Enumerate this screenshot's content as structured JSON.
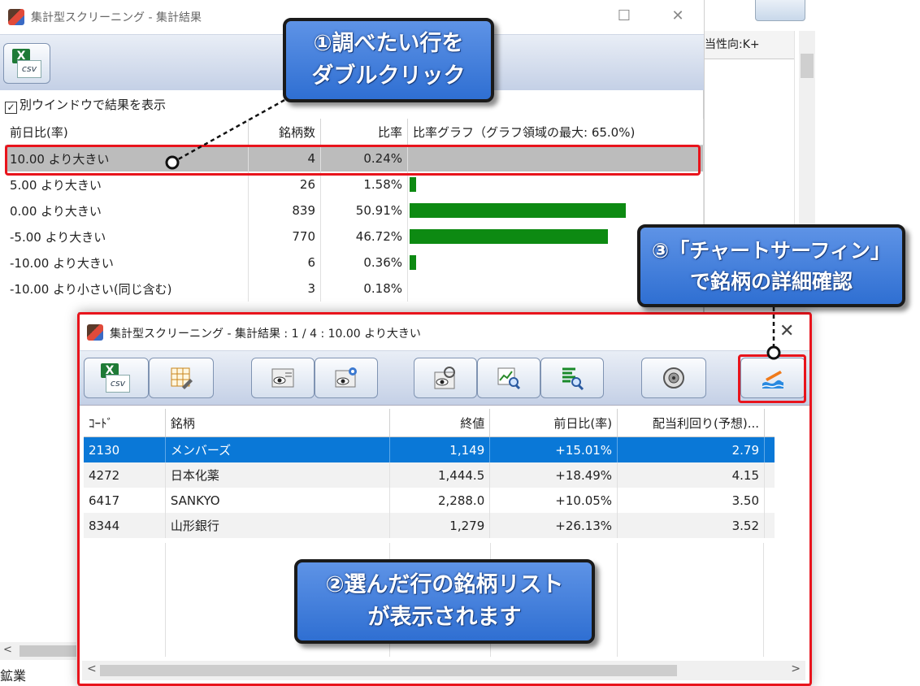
{
  "background_window": {
    "column_header": "当性向:K+",
    "toolbar_button_icon": "chart-surfin-icon"
  },
  "window1": {
    "title": "集計型スクリーニング - 集計結果",
    "toolbar": {
      "csv_icon": "excel-csv-icon",
      "csv_label": "csv",
      "excel_glyph": "X"
    },
    "checkbox_label": "別ウインドウで結果を表示",
    "checkbox_checked": true,
    "table": {
      "headers": [
        "前日比(率)",
        "銘柄数",
        "比率",
        "比率グラフ（グラフ領域の最大: 65.0%)"
      ],
      "rows": [
        {
          "label": "10.00 より大きい",
          "count": "4",
          "ratio": "0.24%",
          "graph": 0.0024
        },
        {
          "label": "5.00 より大きい",
          "count": "26",
          "ratio": "1.58%",
          "graph": 0.0158
        },
        {
          "label": "0.00 より大きい",
          "count": "839",
          "ratio": "50.91%",
          "graph": 0.5091
        },
        {
          "label": "-5.00 より大きい",
          "count": "770",
          "ratio": "46.72%",
          "graph": 0.4672
        },
        {
          "label": "-10.00 より大きい",
          "count": "6",
          "ratio": "0.36%",
          "graph": 0.0036
        },
        {
          "label": "-10.00 より小さい(同じ含む)",
          "count": "3",
          "ratio": "0.18%",
          "graph": 0.0018
        }
      ],
      "graph_max": 0.65,
      "bar_color": "#0d8a12"
    },
    "status_text": "鉱業"
  },
  "window2": {
    "title": "集計型スクリーニング - 集計結果 : 1 / 4 : 10.00 より大きい",
    "toolbar_icons": [
      "excel-csv-icon",
      "edit-grid-icon",
      "eye-list-icon",
      "eye-settings-icon",
      "eye-refresh-icon",
      "chart-search-icon",
      "list-search-icon",
      "speaker-icon",
      "chart-surfin-icon"
    ],
    "table": {
      "headers": [
        "ｺｰﾄﾞ",
        "銘柄",
        "終値",
        "前日比(率)",
        "配当利回り(予想)..."
      ],
      "rows": [
        {
          "code": "2130",
          "name": "メンバーズ",
          "close": "1,149",
          "change": "+15.01%",
          "yield": "2.79"
        },
        {
          "code": "4272",
          "name": "日本化薬",
          "close": "1,444.5",
          "change": "+18.49%",
          "yield": "4.15"
        },
        {
          "code": "6417",
          "name": "SANKYO",
          "close": "2,288.0",
          "change": "+10.05%",
          "yield": "3.50"
        },
        {
          "code": "8344",
          "name": "山形銀行",
          "close": "1,279",
          "change": "+26.13%",
          "yield": "3.52"
        }
      ]
    }
  },
  "callouts": {
    "c1": {
      "line1": "①調べたい行を",
      "line2": "ダブルクリック"
    },
    "c2": {
      "line1": "②選んだ行の銘柄リスト",
      "line2": "が表示されます"
    },
    "c3": {
      "line1": "③「チャートサーフィン」",
      "line2": "で銘柄の詳細確認"
    }
  },
  "colors": {
    "highlight": "#e8141c",
    "callout": "#3b78d8",
    "selection": "#0a78d7"
  }
}
